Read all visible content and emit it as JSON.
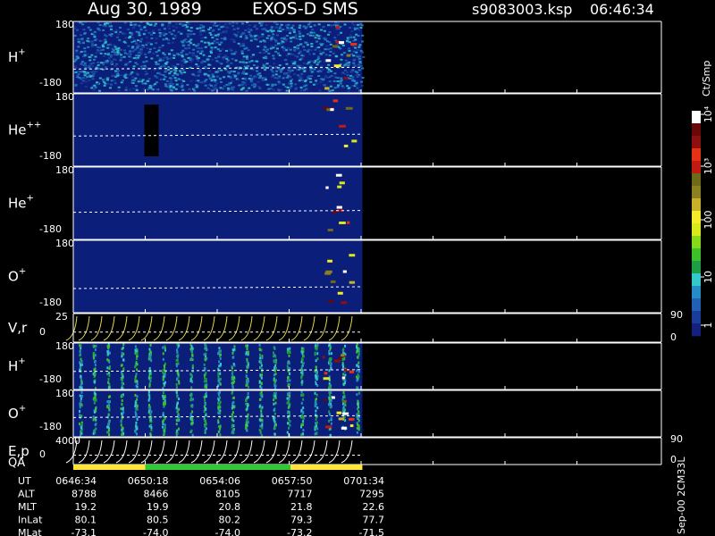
{
  "header": {
    "date": "Aug 30, 1989",
    "instrument": "EXOS-D SMS",
    "file": "s9083003.ksp",
    "time": "06:46:34"
  },
  "colors": {
    "background": "#000000",
    "field": "#0b1e7a",
    "axis": "#ffffff",
    "reference_line": "#ffffff",
    "vr_curve": "#e8d850",
    "ep_curve": "#ffffff",
    "qa_good": "#2fc836",
    "qa_caution": "#ffe43c"
  },
  "colorbar": {
    "label": "Ct/Smp",
    "ticks": [
      "1",
      "10",
      "100",
      "10³",
      "10⁴"
    ],
    "colors": [
      "#14207e",
      "#1a3c9a",
      "#2160b2",
      "#268cc6",
      "#33c8cc",
      "#1e9c46",
      "#3ec02a",
      "#86d81a",
      "#d8e81a",
      "#f4ec2a",
      "#c8b028",
      "#8c8020",
      "#6e6a1a",
      "#c01a12",
      "#e83014",
      "#8c1010",
      "#6a0808",
      "#ffffff"
    ]
  },
  "chart_data": {
    "type": "heatmap",
    "title": "Aug 30, 1989   EXOS-D SMS",
    "data_end_label": "0701:34",
    "panels": [
      {
        "id": "h_plus",
        "label": "H",
        "sup": "+",
        "ylim": [
          -180,
          180
        ],
        "ticks": [
          "180",
          "-180"
        ],
        "ref_level": -60,
        "style": "noisy"
      },
      {
        "id": "he_pp",
        "label": "He",
        "sup": "++",
        "ylim": [
          -180,
          180
        ],
        "ticks": [
          "180",
          "-180"
        ],
        "ref_level": -30,
        "style": "sparse",
        "gap_at": "0650:18"
      },
      {
        "id": "he_plus",
        "label": "He",
        "sup": "+",
        "ylim": [
          -180,
          180
        ],
        "ticks": [
          "180",
          "-180"
        ],
        "ref_level": -45,
        "style": "sparse"
      },
      {
        "id": "o_plus",
        "label": "O",
        "sup": "+",
        "ylim": [
          -180,
          180
        ],
        "ticks": [
          "180",
          "-180"
        ],
        "ref_level": -60,
        "style": "sparse"
      },
      {
        "id": "vr",
        "label": "V,r",
        "ylim": [
          0,
          25
        ],
        "ticks": [
          "25",
          "0"
        ],
        "right_ticks": [
          "90",
          "0"
        ],
        "style": "curves"
      },
      {
        "id": "h_plus_2",
        "label": "H",
        "sup": "+",
        "ylim": [
          -180,
          180
        ],
        "ticks": [
          "180",
          "-180"
        ],
        "ref_level": -40,
        "style": "stripes"
      },
      {
        "id": "o_plus_2",
        "label": "O",
        "sup": "+",
        "ylim": [
          -180,
          180
        ],
        "ticks": [
          "180",
          "-180"
        ],
        "ref_level": -30,
        "style": "stripes"
      },
      {
        "id": "ep",
        "label": "E,p",
        "ylim": [
          0,
          4000
        ],
        "ticks": [
          "4000",
          "0"
        ],
        "right_ticks": [
          "90",
          "0"
        ],
        "style": "curves"
      }
    ],
    "qa": {
      "label": "QA",
      "segments": [
        {
          "from": "0646:34",
          "to": "0650:18",
          "state": "caution"
        },
        {
          "from": "0650:18",
          "to": "0657:50",
          "state": "good"
        },
        {
          "from": "0657:50",
          "to": "0701:34",
          "state": "caution"
        },
        {
          "from": "0701:34",
          "to": "0701:34",
          "state": "good"
        }
      ]
    },
    "orbit": {
      "rows": [
        {
          "label": "UT",
          "values": [
            "0646:34",
            "0650:18",
            "0654:06",
            "0657:50",
            "0701:34"
          ]
        },
        {
          "label": "ALT",
          "values": [
            "8788",
            "8466",
            "8105",
            "7717",
            "7295"
          ]
        },
        {
          "label": "MLT",
          "values": [
            "19.2",
            "19.9",
            "20.8",
            "21.8",
            "22.6"
          ]
        },
        {
          "label": "InLat",
          "values": [
            "80.1",
            "80.5",
            "80.2",
            "79.3",
            "77.7"
          ]
        },
        {
          "label": "MLat",
          "values": [
            "-73.1",
            "-74.0",
            "-74.0",
            "-73.2",
            "-71.5"
          ]
        }
      ]
    },
    "footer_note": "Sep-00 2CM33L"
  }
}
